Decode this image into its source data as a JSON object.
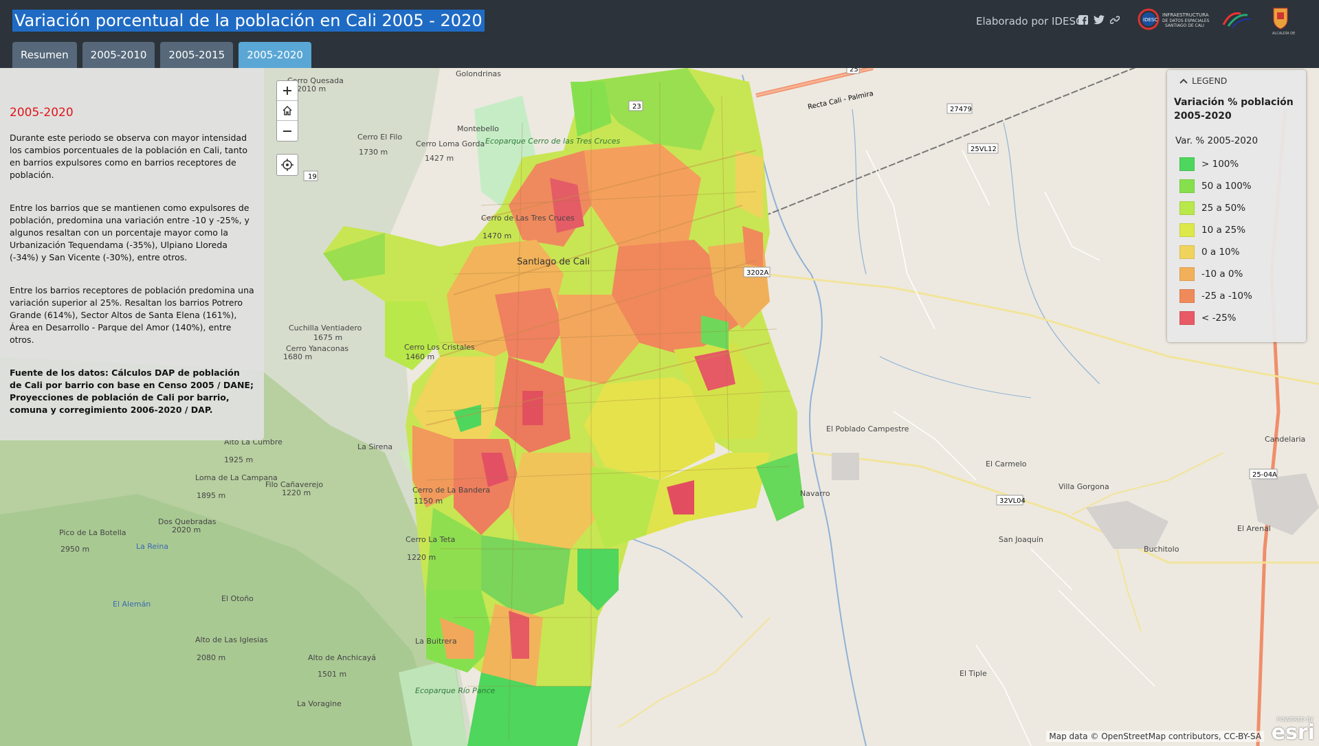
{
  "header": {
    "title": "Variación porcentual de la población en Cali 2005 - 2020",
    "byline": "Elaborado por IDESC",
    "tabs": [
      {
        "label": "Resumen"
      },
      {
        "label": "2005-2010"
      },
      {
        "label": "2005-2015"
      },
      {
        "label": "2005-2020"
      }
    ]
  },
  "panel": {
    "heading": "2005-2020",
    "paragraphs": [
      "Durante este periodo se observa con mayor intensidad los cambios porcentuales de la población en Cali, tanto en barrios expulsores como en barrios receptores de población.",
      "Entre los barrios que se mantienen como expulsores de población, predomina una variación entre -10 y -25%, y algunos resaltan con un porcentaje mayor como la Urbanización Tequendama (-35%), Ulpiano Lloreda (-34%) y San Vicente (-30%), entre otros.",
      "Entre los barrios receptores de población predomina una variación superior al 25%. Resaltan los barrios Potrero Grande (614%), Sector Altos de Santa Elena (161%), Área en Desarrollo - Parque del Amor (140%), entre otros.",
      "Fuente de los datos: Cálculos DAP de población de Cali por barrio con base en Censo 2005 / DANE; Proyecciones de población de Cali por barrio, comuna y corregimiento 2006-2020 / DAP."
    ]
  },
  "legend": {
    "header": "LEGEND",
    "title": "Variación % población 2005-2020",
    "subtitle": "Var. % 2005-2020",
    "classes": [
      {
        "label": "> 100%",
        "color": "#4fd65c"
      },
      {
        "label": "50 a 100%",
        "color": "#86e04e"
      },
      {
        "label": "25 a 50%",
        "color": "#b9e84a"
      },
      {
        "label": "10 a 25%",
        "color": "#dde84a"
      },
      {
        "label": "0 a 10%",
        "color": "#f0d35c"
      },
      {
        "label": "-10 a 0%",
        "color": "#f2b05a"
      },
      {
        "label": "-25 a -10%",
        "color": "#f08a5a"
      },
      {
        "label": "< -25%",
        "color": "#e85a66"
      }
    ]
  },
  "map": {
    "places": [
      {
        "name": "Golondrinas"
      },
      {
        "name": "Montebello"
      },
      {
        "name": "Santiago de Cali"
      },
      {
        "name": "La Sirena"
      },
      {
        "name": "La Buitrera"
      },
      {
        "name": "La Voragine"
      },
      {
        "name": "Navarro"
      },
      {
        "name": "El Carmelo"
      },
      {
        "name": "Villa Gorgona"
      },
      {
        "name": "San Joaquín"
      },
      {
        "name": "Buchitolo"
      },
      {
        "name": "El Arenal"
      },
      {
        "name": "Candelaria"
      },
      {
        "name": "El Poblado Campestre"
      },
      {
        "name": "El Tiple"
      },
      {
        "name": "Cerro Quesada",
        "elev": "2010 m"
      },
      {
        "name": "Cerro El Filo",
        "elev": "1730 m"
      },
      {
        "name": "Cerro Loma Gorda",
        "elev": "1427 m"
      },
      {
        "name": "Cerro de Las Tres Cruces",
        "elev": "1470 m"
      },
      {
        "name": "Cuchilla Ventiadero",
        "elev": "1675 m"
      },
      {
        "name": "Cerro Yanaconas",
        "elev": "1680 m"
      },
      {
        "name": "Cerro Los Cristales",
        "elev": "1460 m"
      },
      {
        "name": "Alto La Cumbre",
        "elev": "1925 m"
      },
      {
        "name": "Loma de La Campana",
        "elev": "1895 m"
      },
      {
        "name": "Filo Cañaverejo",
        "elev": "1220 m"
      },
      {
        "name": "Cerro de La Bandera",
        "elev": "1150 m"
      },
      {
        "name": "Dos Quebradas",
        "elev": "2020 m"
      },
      {
        "name": "Pico de La Botella",
        "elev": "2950 m"
      },
      {
        "name": "El Otoño",
        "elev": ""
      },
      {
        "name": "Alto de Anchicayá",
        "elev": "1501 m"
      },
      {
        "name": "Alto de Las Iglesias",
        "elev": "2080 m"
      },
      {
        "name": "Cerro La Teta",
        "elev": "1220 m"
      },
      {
        "name": "Ecoparque Cerro de las Tres Cruces"
      },
      {
        "name": "Ecoparque Río Pance"
      },
      {
        "name": "La Reina"
      },
      {
        "name": "El Alemán"
      }
    ],
    "road_labels": [
      "25",
      "23",
      "19",
      "27479",
      "25VL12",
      "3202A",
      "32VL04",
      "25-04A",
      "Recta Cali - Palmira"
    ],
    "attribution": "Map data © OpenStreetMap contributors, CC-BY-SA",
    "esri_text": "esri",
    "esri_powered": "POWERED BY"
  }
}
